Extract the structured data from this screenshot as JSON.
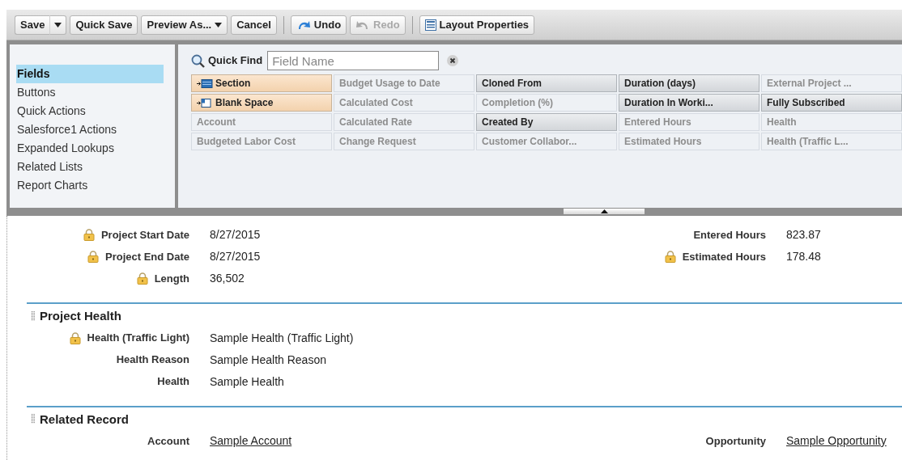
{
  "toolbar": {
    "groups": [
      [
        {
          "label": "Save",
          "kind": "split",
          "disabled": false
        },
        {
          "label": "Quick Save",
          "kind": "plain",
          "disabled": false
        },
        {
          "label": "Preview As...",
          "kind": "menu",
          "disabled": false
        },
        {
          "label": "Cancel",
          "kind": "plain",
          "disabled": false
        }
      ],
      [
        {
          "label": "Undo",
          "kind": "undo",
          "disabled": false
        },
        {
          "label": "Redo",
          "kind": "redo",
          "disabled": true
        }
      ],
      [
        {
          "label": "Layout Properties",
          "kind": "properties",
          "disabled": false
        }
      ]
    ]
  },
  "palette": {
    "categories": [
      {
        "label": "Fields",
        "selected": true
      },
      {
        "label": "Buttons",
        "selected": false
      },
      {
        "label": "Quick Actions",
        "selected": false
      },
      {
        "label": "Salesforce1 Actions",
        "selected": false
      },
      {
        "label": "Expanded Lookups",
        "selected": false
      },
      {
        "label": "Related Lists",
        "selected": false
      },
      {
        "label": "Report Charts",
        "selected": false
      }
    ],
    "quick_find": {
      "label": "Quick Find",
      "placeholder": "Field Name"
    },
    "items": [
      {
        "label": "Section",
        "kind": "section"
      },
      {
        "label": "Budget Usage to Date",
        "kind": "field",
        "on_layout": true
      },
      {
        "label": "Cloned From",
        "kind": "field",
        "on_layout": false
      },
      {
        "label": "Duration (days)",
        "kind": "field",
        "on_layout": false
      },
      {
        "label": "External Project ...",
        "kind": "field",
        "on_layout": true
      },
      {
        "label": "Blank Space",
        "kind": "blank"
      },
      {
        "label": "Calculated Cost",
        "kind": "field",
        "on_layout": true
      },
      {
        "label": "Completion (%)",
        "kind": "field",
        "on_layout": true
      },
      {
        "label": "Duration In Worki...",
        "kind": "field",
        "on_layout": false
      },
      {
        "label": "Fully Subscribed",
        "kind": "field",
        "on_layout": false
      },
      {
        "label": "Account",
        "kind": "field",
        "on_layout": true
      },
      {
        "label": "Calculated Rate",
        "kind": "field",
        "on_layout": true
      },
      {
        "label": "Created By",
        "kind": "field",
        "on_layout": false
      },
      {
        "label": "Entered Hours",
        "kind": "field",
        "on_layout": true
      },
      {
        "label": "Health",
        "kind": "field",
        "on_layout": true
      },
      {
        "label": "Budgeted Labor Cost",
        "kind": "field",
        "on_layout": true
      },
      {
        "label": "Change Request",
        "kind": "field",
        "on_layout": true
      },
      {
        "label": "Customer Collabor...",
        "kind": "field",
        "on_layout": true
      },
      {
        "label": "Estimated Hours",
        "kind": "field",
        "on_layout": true
      },
      {
        "label": "Health (Traffic L...",
        "kind": "field",
        "on_layout": true
      }
    ]
  },
  "layout": {
    "sections": [
      {
        "rows": [
          {
            "left": {
              "label": "Project Start Date",
              "value": "8/27/2015",
              "locked": true
            },
            "right": {
              "label": "Entered Hours",
              "value": "823.87"
            }
          },
          {
            "left": {
              "label": "Project End Date",
              "value": "8/27/2015",
              "locked": true
            },
            "right": {
              "label": "Estimated Hours",
              "value": "178.48",
              "locked": true
            }
          },
          {
            "left": {
              "label": "Length",
              "value": "36,502",
              "locked": true
            }
          }
        ]
      },
      {
        "title": "Project Health",
        "rows": [
          {
            "left": {
              "label": "Health (Traffic Light)",
              "value": "Sample Health (Traffic Light)",
              "locked": true
            }
          },
          {
            "left": {
              "label": "Health Reason",
              "value": "Sample Health Reason"
            }
          },
          {
            "left": {
              "label": "Health",
              "value": "Sample Health"
            }
          }
        ]
      },
      {
        "title": "Related Record",
        "rows": [
          {
            "left": {
              "label": "Account",
              "value": "Sample Account",
              "link": true
            },
            "right": {
              "label": "Opportunity",
              "value": "Sample Opportunity",
              "link": true
            }
          }
        ]
      }
    ]
  }
}
